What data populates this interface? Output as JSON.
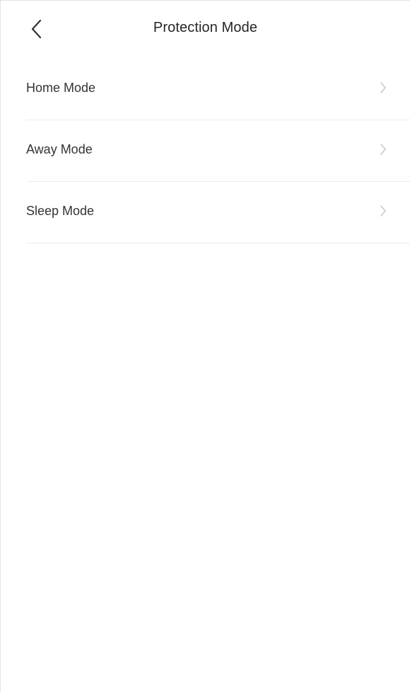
{
  "header": {
    "title": "Protection Mode",
    "back_icon": "chevron-left-icon"
  },
  "modes": [
    {
      "label": "Home Mode",
      "icon": "chevron-right-icon"
    },
    {
      "label": "Away Mode",
      "icon": "chevron-right-icon"
    },
    {
      "label": "Sleep Mode",
      "icon": "chevron-right-icon"
    }
  ],
  "colors": {
    "background": "#ffffff",
    "text": "#333333",
    "divider": "#ececec",
    "chevron": "#c8c8c8"
  }
}
